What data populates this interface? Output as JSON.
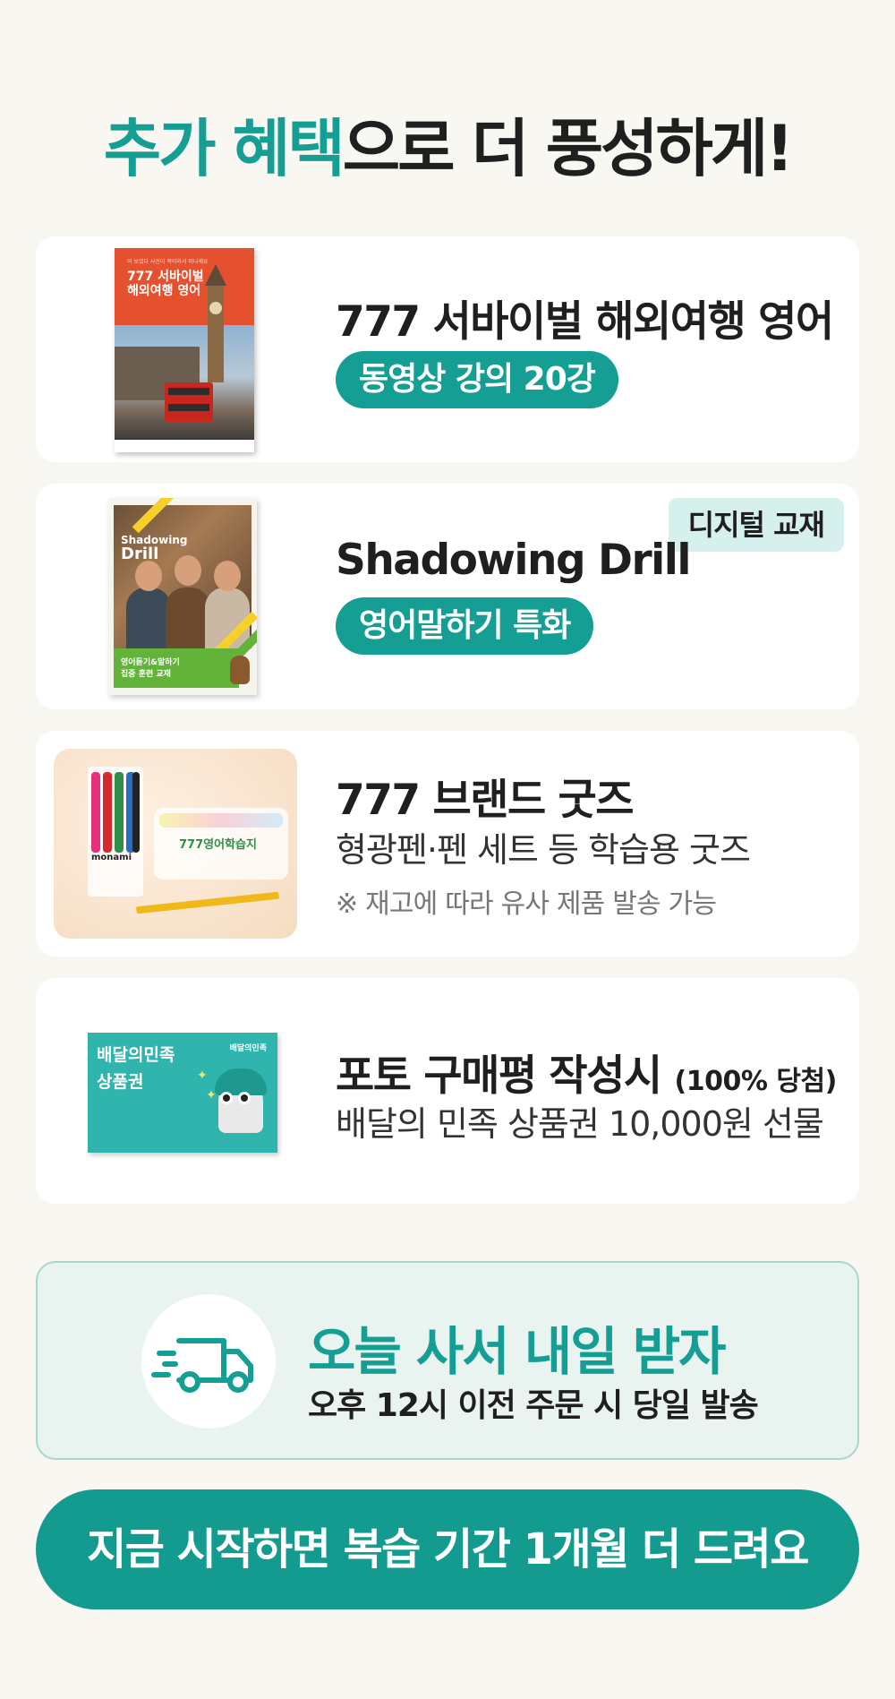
{
  "headline": {
    "accent": "추가 혜택",
    "rest": "으로 더 풍성하게!"
  },
  "benefits": [
    {
      "title": "777 서바이벌 해외여행 영어",
      "pill": "동영상 강의 20강",
      "cover_top": "이 보였다 사진이 쪽이라서 떠나세요",
      "cover_title_1": "777 서바이벌",
      "cover_title_2": "해외여행 영어"
    },
    {
      "title": "Shadowing Drill",
      "pill": "영어말하기 특화",
      "tag": "디지털 교재",
      "cover_title_1": "Shadowing",
      "cover_title_2": "Drill",
      "cover_bottom_1": "영어듣기&말하기",
      "cover_bottom_2": "집중 훈련 교재"
    },
    {
      "title": "777 브랜드 굿즈",
      "subtitle": "형광펜·펜 세트 등 학습용 굿즈",
      "note": "※ 재고에 따라 유사 제품 발송 가능",
      "pen_brand": "monami",
      "case_label": "777영어학습지"
    },
    {
      "title": "포토 구매평 작성시",
      "title_small": "(100% 당첨)",
      "subtitle": "배달의 민족 상품권 10,000원 선물",
      "voucher_line_1": "배달의민족",
      "voucher_line_2": "상품권",
      "voucher_brand": "배달의민족"
    }
  ],
  "delivery": {
    "title": "오늘 사서 내일 받자",
    "subtitle": "오후 12시 이전 주문 시 당일 발송",
    "icon": "delivery-truck-icon"
  },
  "cta": {
    "label": "지금 시작하면 복습 기간 1개월 더 드려요"
  },
  "colors": {
    "accent": "#159e94",
    "background": "#f8f7f2",
    "tag_bg": "#d6f0ee"
  }
}
